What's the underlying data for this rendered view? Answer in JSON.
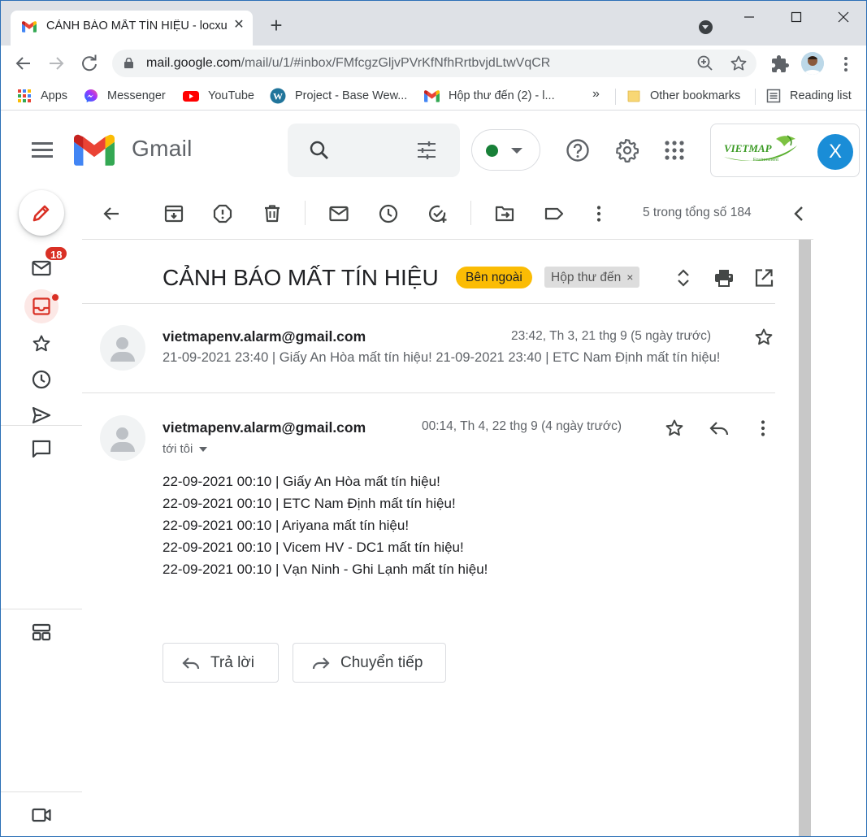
{
  "browser": {
    "tab_title": "CẢNH BÁO MẤT TÍN HIỆU - locxu",
    "url_host": "mail.google.com",
    "url_path": "/mail/u/1/#inbox/FMfcgzGljvPVrKfNfhRrtbvjdLtwVqCR",
    "bookmarks": [
      {
        "label": "Apps",
        "icon": "apps-grid-icon"
      },
      {
        "label": "Messenger",
        "icon": "messenger-icon"
      },
      {
        "label": "YouTube",
        "icon": "youtube-icon"
      },
      {
        "label": "Project - Base Wew...",
        "icon": "wordpress-icon"
      },
      {
        "label": "Hộp thư đến (2) - l...",
        "icon": "gmail-icon"
      }
    ],
    "bookmarks_more": "»",
    "other_bookmarks": "Other bookmarks",
    "reading_list": "Reading list"
  },
  "gmail": {
    "wordmark": "Gmail",
    "account_initial": "X",
    "account_logo_text": "VIETMAP",
    "account_logo_sub": "Environment",
    "unread_badge": "18",
    "status_color": "#188038",
    "accent_red": "#d93025"
  },
  "toolbar": {
    "count_text": "5 trong tổng số 184"
  },
  "thread": {
    "subject": "CẢNH BÁO MẤT TÍN HIỆU",
    "labels": {
      "external": "Bên ngoài",
      "inbox": "Hộp thư đến",
      "inbox_remove": "×"
    },
    "messages": [
      {
        "sender": "vietmapenv.alarm@gmail.com",
        "date": "23:42, Th 3, 21 thg 9 (5 ngày trước)",
        "snippet": "21-09-2021 23:40 | Giấy An Hòa mất tín hiệu! 21-09-2021 23:40 | ETC Nam Định mất tín hiệu!"
      },
      {
        "sender": "vietmapenv.alarm@gmail.com",
        "date": "00:14, Th 4, 22 thg 9 (4 ngày trước)",
        "to": "tới tôi",
        "body": [
          "22-09-2021 00:10 | Giấy An Hòa mất tín hiệu!",
          "22-09-2021 00:10 | ETC Nam Định mất tín hiệu!",
          "22-09-2021 00:10 | Ariyana mất tín hiệu!",
          "22-09-2021 00:10 | Vicem HV - DC1 mất tín hiệu!",
          "22-09-2021 00:10 | Vạn Ninh - Ghi Lạnh mất tín hiệu!"
        ]
      }
    ],
    "reply_label": "Trả lời",
    "forward_label": "Chuyển tiếp"
  }
}
